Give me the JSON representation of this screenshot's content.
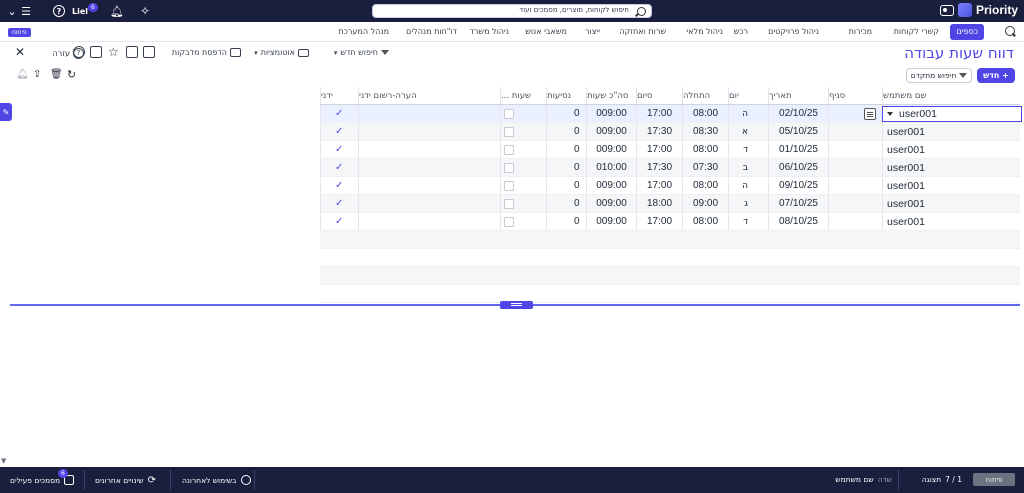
{
  "topbar": {
    "brand": "Priority",
    "search_placeholder": "חיפוש לקוחות, מוצרים, מסמכים ועוד",
    "user_name": "Liel",
    "notif_count": "6"
  },
  "nav": {
    "active": "כספים",
    "items": [
      "קשרי לקוחות",
      "מכירות",
      "ניהול פרויקטים",
      "רכש",
      "ניהול מלאי",
      "שרות ואחזקה",
      "ייצור",
      "משאבי אנוש",
      "ניהול משרד",
      "דו\"חות מנהלים",
      "מנהל המערכת"
    ],
    "dev_badge": "פיתוח"
  },
  "toolbar": {
    "title": "דווח שעות עבודה",
    "new_search": "חיפוש חדש",
    "automations": "אוטומציות",
    "print_labels": "הדפסת מדבקות",
    "help": "עזרה"
  },
  "actions": {
    "new": "+ חדש",
    "advanced_search": "חיפוש מתקדם"
  },
  "grid": {
    "headers": {
      "user": "שם משתמש",
      "branch": "סניף",
      "date": "תאריך",
      "day": "יום",
      "start": "התחלה",
      "end": "סיום",
      "total": "סה\"כ שעות",
      "trips": "נסיעות",
      "hours": "שעות ...",
      "remark": "הערה-רשום ידני",
      "manual": "ידני"
    },
    "rows": [
      {
        "user": "user001",
        "date": "02/10/25",
        "day": "ה",
        "start": "08:00",
        "end": "17:00",
        "total": "009:00",
        "trips": "0",
        "manual": "✓"
      },
      {
        "user": "user001",
        "date": "05/10/25",
        "day": "א",
        "start": "08:30",
        "end": "17:30",
        "total": "009:00",
        "trips": "0",
        "manual": "✓"
      },
      {
        "user": "user001",
        "date": "01/10/25",
        "day": "ד",
        "start": "08:00",
        "end": "17:00",
        "total": "009:00",
        "trips": "0",
        "manual": "✓"
      },
      {
        "user": "user001",
        "date": "06/10/25",
        "day": "ב",
        "start": "07:30",
        "end": "17:30",
        "total": "010:00",
        "trips": "0",
        "manual": "✓"
      },
      {
        "user": "user001",
        "date": "09/10/25",
        "day": "ה",
        "start": "08:00",
        "end": "17:00",
        "total": "009:00",
        "trips": "0",
        "manual": "✓"
      },
      {
        "user": "user001",
        "date": "07/10/25",
        "day": "ג",
        "start": "09:00",
        "end": "18:00",
        "total": "009:00",
        "trips": "0",
        "manual": "✓"
      },
      {
        "user": "user001",
        "date": "08/10/25",
        "day": "ד",
        "start": "08:00",
        "end": "17:00",
        "total": "009:00",
        "trips": "0",
        "manual": "✓"
      }
    ]
  },
  "footer": {
    "dev": "פיתוח",
    "records": "1 / 7",
    "view_label": "תצוגה",
    "field_label": "שדה",
    "field_value": "שם משתמש",
    "recent": "בשימוש לאחרונה",
    "recent_changes": "שינויים אחרונים",
    "active_docs": "מסמכים פעילים",
    "active_docs_count": "6"
  },
  "colors": {
    "accent": "#4f46e5",
    "topbar": "#1a1f3d"
  }
}
